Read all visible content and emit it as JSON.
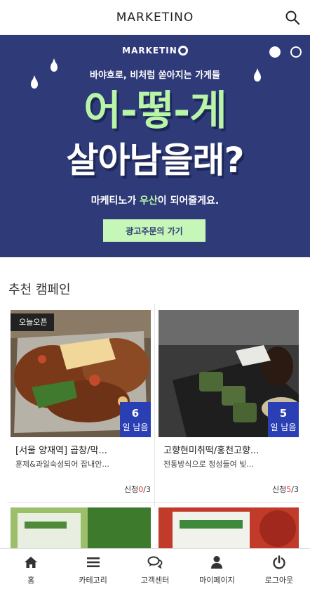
{
  "header": {
    "brand": "MARKETINO"
  },
  "banner": {
    "logo_text": "MARKETIN",
    "subtitle": "바야흐로, 비처럼 쏟아지는 가게들",
    "headline1": "어-떻-게",
    "headline2": "살아남을래?",
    "line_prefix": "마케티노가 ",
    "line_highlight": "우산",
    "line_suffix": "이 되어줄게요.",
    "cta_label": "광고주문의 가기",
    "slide_count": 2,
    "active_slide": 1
  },
  "section": {
    "title": "추천 캠페인"
  },
  "campaigns": [
    {
      "badge": "오늘오픈",
      "days_num": "6",
      "days_unit": "일 남음",
      "title": "[서울 양재역] 곱창/막...",
      "desc": "훈제&과일숙성되어 잡내안...",
      "apply_label": "신청",
      "apply_cur": "0",
      "apply_total": "/3"
    },
    {
      "badge": "",
      "days_num": "5",
      "days_unit": "일 남음",
      "title": "고향현미취떡/홍천고향...",
      "desc": "전통방식으로 정성들여 빚...",
      "apply_label": "신청",
      "apply_cur": "5",
      "apply_total": "/3"
    }
  ],
  "tabs": [
    {
      "label": "홈",
      "icon": "home-icon"
    },
    {
      "label": "카테고리",
      "icon": "menu-icon"
    },
    {
      "label": "고객센터",
      "icon": "chat-icon"
    },
    {
      "label": "마이페이지",
      "icon": "user-icon"
    },
    {
      "label": "로그아웃",
      "icon": "power-icon"
    }
  ],
  "colors": {
    "banner_bg": "#2f3a78",
    "banner_accent": "#b8f5a8",
    "days_badge": "#2b3fb5",
    "apply_current": "#e33333"
  }
}
